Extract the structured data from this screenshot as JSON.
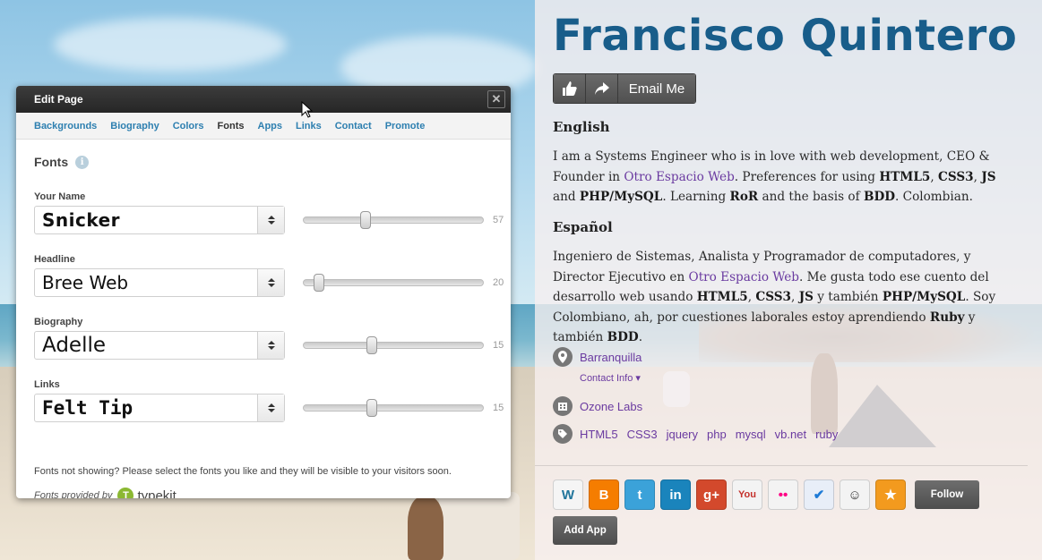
{
  "profile": {
    "name": "Francisco Quintero",
    "email_label": "Email Me",
    "english_title": "English",
    "spanish_title": "Español",
    "location": "Barranquilla",
    "contact_info": "Contact Info",
    "company": "Ozone Labs",
    "tags": [
      "HTML5",
      "CSS3",
      "jquery",
      "php",
      "mysql",
      "vb.net",
      "ruby"
    ],
    "follow_label": "Follow",
    "add_app_label": "Add App",
    "apps": [
      {
        "name": "wordpress",
        "glyph": "W",
        "color": "#f5f5f5",
        "fg": "#21759b"
      },
      {
        "name": "blogger",
        "glyph": "B",
        "color": "#f57d00",
        "fg": "#ffffff"
      },
      {
        "name": "twitter",
        "glyph": "t",
        "color": "#3ba2d9",
        "fg": "#ffffff"
      },
      {
        "name": "linkedin",
        "glyph": "in",
        "color": "#1a84bc",
        "fg": "#ffffff"
      },
      {
        "name": "google-plus",
        "glyph": "g+",
        "color": "#d3492c",
        "fg": "#ffffff"
      },
      {
        "name": "youtube",
        "glyph": "You",
        "color": "#f3f3f3",
        "fg": "#c4302b"
      },
      {
        "name": "flickr",
        "glyph": "••",
        "color": "#f3f3f3",
        "fg": "#ff0084"
      },
      {
        "name": "foursquare",
        "glyph": "✔",
        "color": "#e8eef8",
        "fg": "#1d7ad6"
      },
      {
        "name": "github",
        "glyph": "☺",
        "color": "#f3f3f3",
        "fg": "#333333"
      },
      {
        "name": "favorites",
        "glyph": "★",
        "color": "#f39a1e",
        "fg": "#ffffff"
      }
    ]
  },
  "dialog": {
    "title": "Edit Page",
    "tabs": [
      "Backgrounds",
      "Biography",
      "Colors",
      "Fonts",
      "Apps",
      "Links",
      "Contact",
      "Promote"
    ],
    "active_tab": "Fonts",
    "heading": "Fonts",
    "rows": [
      {
        "label": "Your Name",
        "font": "Snicker",
        "value": "57",
        "fraction": 0.33
      },
      {
        "label": "Headline",
        "font": "Bree Web",
        "value": "20",
        "fraction": 0.06
      },
      {
        "label": "Biography",
        "font": "Adelle",
        "value": "15",
        "fraction": 0.37
      },
      {
        "label": "Links",
        "font": "Felt Tip",
        "value": "15",
        "fraction": 0.37
      }
    ],
    "note": "Fonts not showing? Please select the fonts you like and they will be visible to your visitors soon.",
    "provided_by": "Fonts provided by",
    "provider": "typekit"
  }
}
